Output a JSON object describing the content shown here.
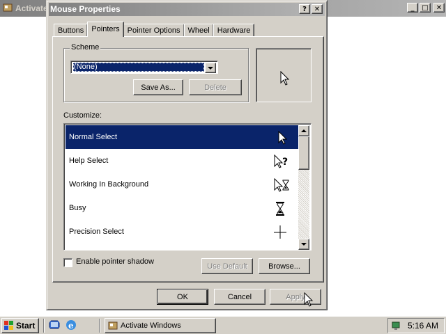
{
  "background_window": {
    "title": "Activate Windows"
  },
  "dialog": {
    "title": "Mouse Properties",
    "help_btn": "?",
    "close_btn": "✕",
    "tabs": [
      {
        "label": "Buttons",
        "active": false
      },
      {
        "label": "Pointers",
        "active": true
      },
      {
        "label": "Pointer Options",
        "active": false
      },
      {
        "label": "Wheel",
        "active": false
      },
      {
        "label": "Hardware",
        "active": false
      }
    ],
    "scheme": {
      "group_label": "Scheme",
      "selected": "(None)",
      "save_as_label": "Save As...",
      "delete_label": "Delete"
    },
    "customize": {
      "label": "Customize:",
      "items": [
        {
          "label": "Normal Select",
          "icon": "arrow-pointer-icon",
          "selected": true
        },
        {
          "label": "Help Select",
          "icon": "help-pointer-icon",
          "selected": false
        },
        {
          "label": "Working In Background",
          "icon": "working-pointer-icon",
          "selected": false
        },
        {
          "label": "Busy",
          "icon": "hourglass-icon",
          "selected": false
        },
        {
          "label": "Precision Select",
          "icon": "crosshair-icon",
          "selected": false
        }
      ]
    },
    "enable_shadow_label": "Enable pointer shadow",
    "enable_shadow_checked": false,
    "use_default_label": "Use Default",
    "browse_label": "Browse...",
    "ok_label": "OK",
    "cancel_label": "Cancel",
    "apply_label": "Apply"
  },
  "taskbar": {
    "start_label": "Start",
    "task_label": "Activate Windows",
    "clock": "5:16 AM"
  }
}
